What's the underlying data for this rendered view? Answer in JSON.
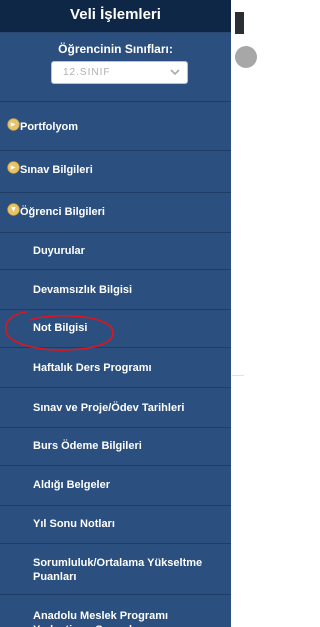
{
  "title": "Veli İşlemleri",
  "grade": {
    "label": "Öğrencinin Sınıfları:",
    "selected": "12.SINIF"
  },
  "menu": [
    {
      "label": "Portfolyom",
      "kind": "section",
      "icon": "expand-bullet-icon"
    },
    {
      "label": "Sınav Bilgileri",
      "kind": "section",
      "icon": "expand-bullet-icon"
    },
    {
      "label": "Öğrenci Bilgileri",
      "kind": "section",
      "icon": "collapse-bullet-icon"
    },
    {
      "label": "Duyurular",
      "kind": "item"
    },
    {
      "label": "Devamsızlık Bilgisi",
      "kind": "item"
    },
    {
      "label": "Not Bilgisi",
      "kind": "item",
      "highlighted": true
    },
    {
      "label": "Haftalık Ders Programı",
      "kind": "item"
    },
    {
      "label": "Sınav ve Proje/Ödev Tarihleri",
      "kind": "item"
    },
    {
      "label": "Burs Ödeme Bilgileri",
      "kind": "item"
    },
    {
      "label": "Aldığı Belgeler",
      "kind": "item"
    },
    {
      "label": "Yıl Sonu Notları",
      "kind": "item"
    },
    {
      "label": "Sorumluluk/Ortalama Yükseltme Puanları",
      "kind": "item"
    },
    {
      "label": "Anadolu Meslek Programı Yerleştirme Sonuçları",
      "kind": "item"
    }
  ],
  "annotation_color": "#e3141a",
  "icon_color": "#e7c36a"
}
